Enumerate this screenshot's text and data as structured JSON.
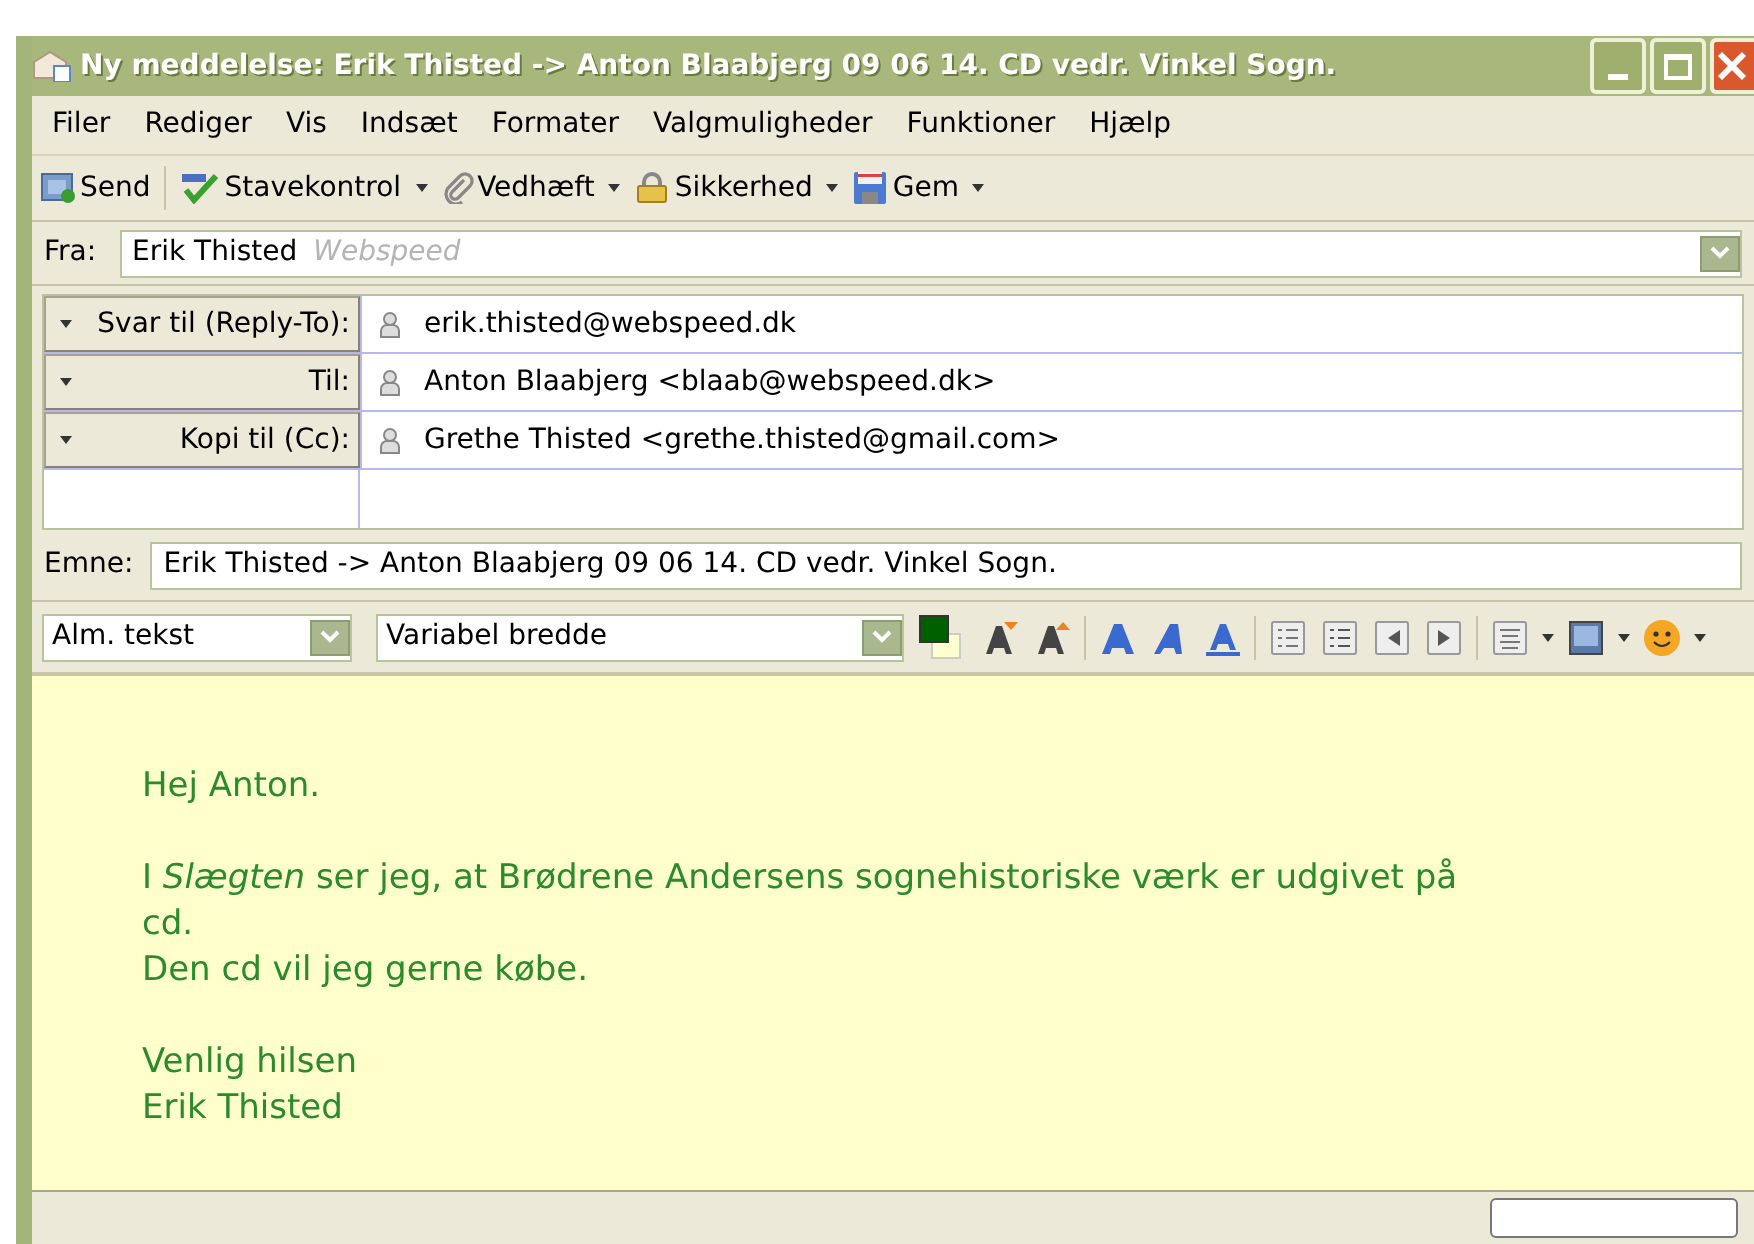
{
  "window": {
    "title": "Ny meddelelse: Erik Thisted -> Anton Blaabjerg 09 06 14. CD vedr. Vinkel Sogn."
  },
  "menu": [
    "Filer",
    "Rediger",
    "Vis",
    "Indsæt",
    "Formater",
    "Valgmuligheder",
    "Funktioner",
    "Hjælp"
  ],
  "toolbar": [
    {
      "kind": "send",
      "label": "Send",
      "dropdown": false
    },
    {
      "kind": "spell",
      "label": "Stavekontrol",
      "dropdown": true
    },
    {
      "kind": "attach",
      "label": "Vedhæft",
      "dropdown": true
    },
    {
      "kind": "security",
      "label": "Sikkerhed",
      "dropdown": true
    },
    {
      "kind": "save",
      "label": "Gem",
      "dropdown": true
    }
  ],
  "from": {
    "label": "Fra:",
    "name": "Erik Thisted",
    "account": "Webspeed"
  },
  "recipients": [
    {
      "type": "Svar til (Reply-To):",
      "address": "erik.thisted@webspeed.dk"
    },
    {
      "type": "Til:",
      "address": "Anton Blaabjerg <blaab@webspeed.dk>"
    },
    {
      "type": "Kopi til (Cc):",
      "address": "Grethe Thisted <grethe.thisted@gmail.com>"
    }
  ],
  "subject": {
    "label": "Emne:",
    "value": "Erik Thisted -> Anton Blaabjerg 09 06 14. CD vedr. Vinkel Sogn."
  },
  "format": {
    "paragraph": "Alm. tekst",
    "font": "Variabel bredde"
  },
  "body": [
    [
      "Hej Anton."
    ],
    [
      "I *Slægten* ser jeg, at Brødrene Andersens sognehistoriske værk er udgivet på cd.",
      "Den cd vil jeg gerne købe."
    ],
    [
      "Venlig hilsen",
      "Erik Thisted"
    ]
  ]
}
